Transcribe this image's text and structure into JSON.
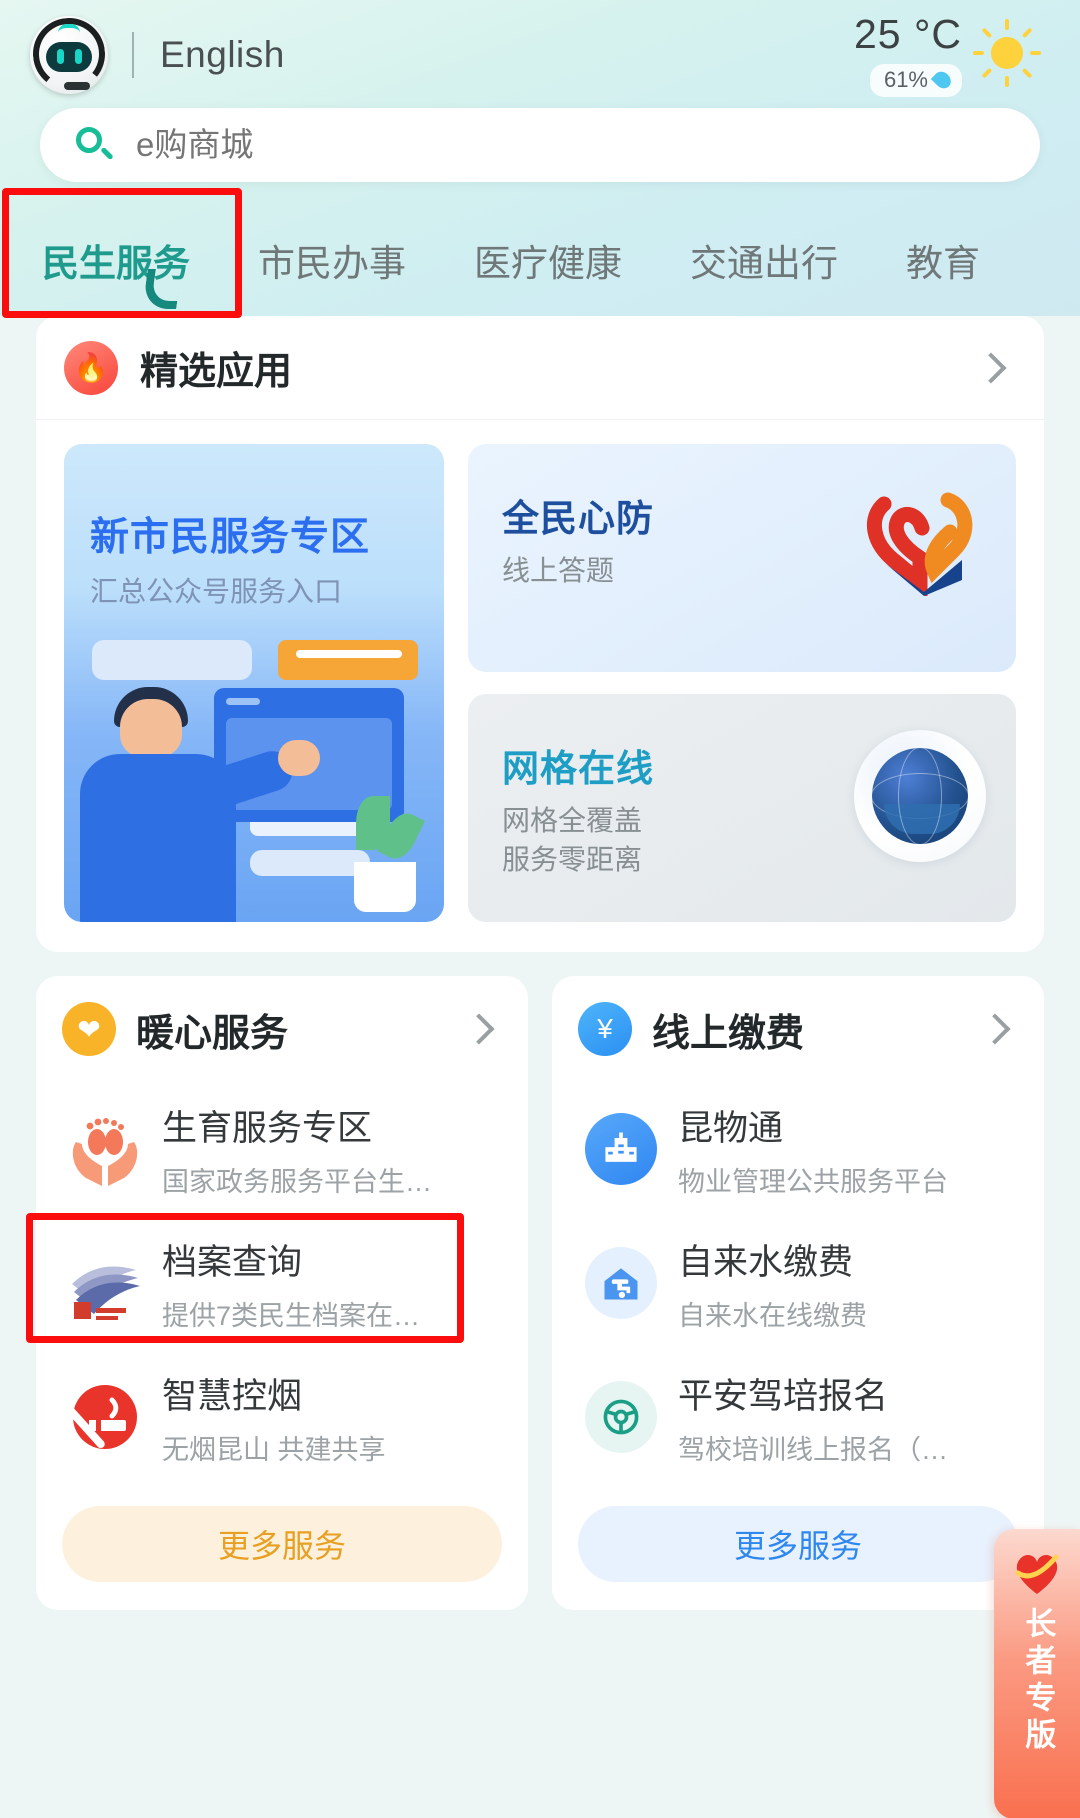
{
  "header": {
    "assistant_icon": "robot-avatar-icon",
    "language": "English",
    "weather": {
      "temperature": "25 °C",
      "humidity": "61%",
      "condition_icon": "sun-icon",
      "humidity_icon": "water-drop-icon"
    }
  },
  "search": {
    "icon": "search-icon",
    "placeholder": "e购商城",
    "value": ""
  },
  "tabs": [
    {
      "label": "民生服务",
      "active": true
    },
    {
      "label": "市民办事",
      "active": false
    },
    {
      "label": "医疗健康",
      "active": false
    },
    {
      "label": "交通出行",
      "active": false
    },
    {
      "label": "教育",
      "active": false
    }
  ],
  "featured": {
    "icon": "fire-badge-icon",
    "title": "精选应用",
    "more_icon": "chevron-right-icon",
    "banner_main": {
      "title": "新市民服务专区",
      "subtitle": "汇总公众号服务入口"
    },
    "banner_small": [
      {
        "title": "全民心防",
        "subtitle": "线上答题",
        "icon": "heart-ribbon-logo"
      },
      {
        "title": "网格在线",
        "subtitle_line1": "网格全覆盖",
        "subtitle_line2": "服务零距离",
        "icon": "globe-logo"
      }
    ]
  },
  "columns": [
    {
      "icon": "heart-badge-icon",
      "title": "暖心服务",
      "more_icon": "chevron-right-icon",
      "items": [
        {
          "name": "生育服务专区",
          "desc": "国家政务服务平台生…",
          "icon": "hands-baby-feet-icon"
        },
        {
          "name": "档案查询",
          "desc": "提供7类民生档案在…",
          "icon": "archive-files-icon",
          "highlighted": true
        },
        {
          "name": "智慧控烟",
          "desc": "无烟昆山 共建共享",
          "icon": "no-smoking-icon"
        }
      ],
      "more_label": "更多服务"
    },
    {
      "icon": "money-bag-badge-icon",
      "title": "线上缴费",
      "more_icon": "chevron-right-icon",
      "items": [
        {
          "name": "昆物通",
          "desc": "物业管理公共服务平台",
          "icon": "building-icon"
        },
        {
          "name": "自来水缴费",
          "desc": "自来水在线缴费",
          "icon": "water-tap-house-icon"
        },
        {
          "name": "平安驾培报名",
          "desc": "驾校培训线上报名（…",
          "icon": "steering-wheel-icon"
        }
      ],
      "more_label": "更多服务"
    }
  ],
  "elder_mode": {
    "label": "长者专版",
    "icon": "heart-ribbon-icon"
  },
  "annotations": {
    "accent_color": "#fb0d0d",
    "boxes": [
      {
        "name": "tab-minsheng-fuwu-highlight"
      },
      {
        "name": "archive-query-item-highlight"
      }
    ]
  }
}
